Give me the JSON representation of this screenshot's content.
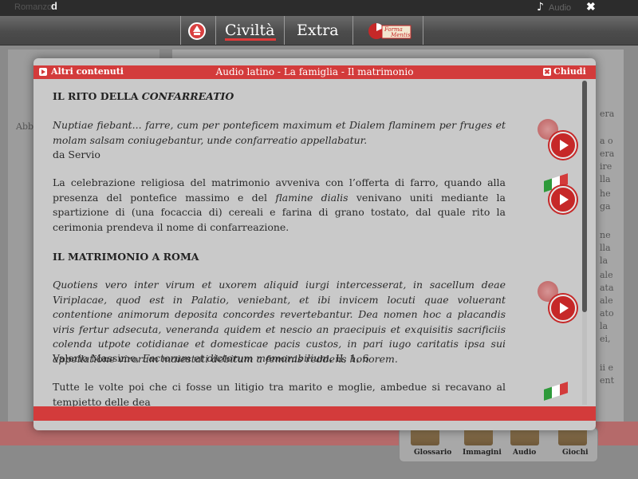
{
  "topbar": {
    "crumb": "Romanzo",
    "logo": "d",
    "audio_label": "Audio"
  },
  "nav": {
    "civilta": "Civiltà",
    "extra": "Extra",
    "forma_mentis": "Forma Mentis"
  },
  "bg": {
    "left_text": "Abb",
    "right_fragments": [
      "era",
      "a o",
      "era",
      "ire",
      "lla",
      "he",
      "ga",
      "ne",
      "lla",
      "la",
      "ale",
      "ata",
      "ale",
      "ato",
      "la",
      "ei,",
      "ii e",
      "ent"
    ],
    "bottom_labels": [
      "Glossario",
      "Immagini",
      "Audio",
      "Giochi"
    ]
  },
  "modal": {
    "left_link": "Altri contenuti",
    "title": "Audio latino - La famiglia - Il matrimonio",
    "close": "Chiudi",
    "section1": {
      "heading_prefix": "IL RITO DELLA ",
      "heading_italic": "CONFARREATIO",
      "latin": "Nuptiae fiebant... farre, cum per ponteficem maximum et Dialem flaminem per fruges et molam salsam coniugebantur, unde confarreatio appellabatur.",
      "source": "da Servio",
      "italian_a": "La celebrazione religiosa del matrimonio avveniva con l’offerta di farro, quando alla presenza del pontefice massimo e del ",
      "italian_italic": "flamine dialis",
      "italian_b": " venivano uniti mediante la spartizione di (una focaccia di) cereali e farina di grano tostato, dal quale rito la cerimonia prendeva il nome di confarreazione."
    },
    "section2": {
      "heading": "IL MATRIMONIO A ROMA",
      "latin": "Quotiens vero inter virum et uxorem aliquid iurgi intercesserat, in sacellum deae Viriplacae, quod est in Palatio, veniebant, et ibi invicem locuti quae voluerant contentione animorum deposita concordes revertebantur. Dea nomen hoc a placandis viris fertur adsecuta, veneranda quidem et nescio an praecipuis et exquisitis sacrificiis colenda utpote cotidianae et domesticae pacis custos, in pari iugo caritatis ipsa sui appellatione virorum maiestati debitum a feminis reddens honorem.",
      "source_a": "Valerio Massimo, ",
      "source_italic": "Factorum et dictorum memorabilium",
      "source_b": ", II, 1, 6",
      "italian": "Tutte le volte poi che ci fosse un litigio tra marito e moglie, ambedue si recavano al tempietto delle dea"
    }
  }
}
